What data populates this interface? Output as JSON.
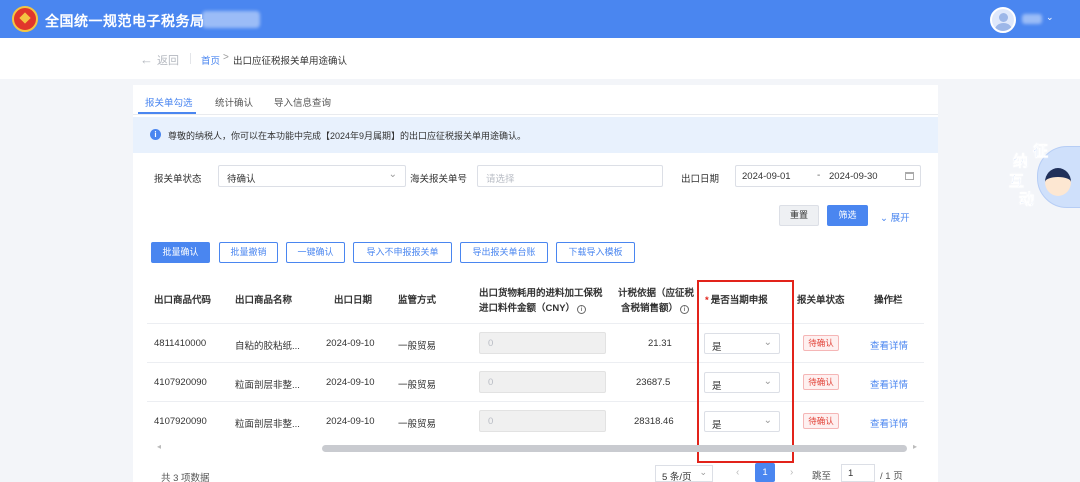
{
  "header": {
    "title": "全国统一规范电子税务局"
  },
  "breadcrumb": {
    "back_label": "返回",
    "home": "首页",
    "separator": ">",
    "current": "出口应征税报关单用途确认"
  },
  "tabs": [
    {
      "label": "报关单勾选",
      "active": true
    },
    {
      "label": "统计确认",
      "active": false
    },
    {
      "label": "导入信息查询",
      "active": false
    }
  ],
  "notice": {
    "icon": "info-icon",
    "text": "尊敬的纳税人，你可以在本功能中完成【2024年9月属期】的出口应征税报关单用途确认。"
  },
  "filters": {
    "status_label": "报关单状态",
    "status_value": "待确认",
    "customs_no_label": "海关报关单号",
    "customs_no_placeholder": "请选择",
    "export_date_label": "出口日期",
    "date_from": "2024-09-01",
    "date_sep": "-",
    "date_to": "2024-09-30",
    "reset_label": "重置",
    "search_label": "筛选",
    "expand_label": "展开"
  },
  "actions": [
    "批量确认",
    "批量撤销",
    "一键确认",
    "导入不申报报关单",
    "导出报关单台账",
    "下载导入模板"
  ],
  "table": {
    "headers": {
      "code": "出口商品代码",
      "name": "出口商品名称",
      "date": "出口日期",
      "supervision": "监管方式",
      "material_line1": "出口货物耗用的进料加工保税",
      "material_line2": "进口料件金额（CNY）",
      "tax_basis_line1": "计税依据（应征税",
      "tax_basis_line2": "含税销售额）",
      "declare": "是否当期申报",
      "status": "报关单状态",
      "ops": "操作栏"
    },
    "rows": [
      {
        "code": "4811410000",
        "name": "自粘的胶粘纸...",
        "date": "2024-09-10",
        "supervision": "一般贸易",
        "material": "0",
        "tax_basis": "21.31",
        "declare": "是",
        "status": "待确认",
        "op": "查看详情"
      },
      {
        "code": "4107920090",
        "name": "粒面剖层非整...",
        "date": "2024-09-10",
        "supervision": "一般贸易",
        "material": "0",
        "tax_basis": "23687.5",
        "declare": "是",
        "status": "待确认",
        "op": "查看详情"
      },
      {
        "code": "4107920090",
        "name": "粒面剖层非整...",
        "date": "2024-09-10",
        "supervision": "一般贸易",
        "material": "0",
        "tax_basis": "28318.46",
        "declare": "是",
        "status": "待确认",
        "op": "查看详情"
      }
    ]
  },
  "pagination": {
    "total": "共 3 项数据",
    "page_size": "5 条/页",
    "current_page": "1",
    "goto_label": "跳至",
    "goto_value": "1",
    "pages": "/ 1 页"
  },
  "mascot": {
    "chars": [
      "征",
      "纳",
      "互",
      "动"
    ]
  },
  "colors": {
    "primary": "#4a86f0",
    "highlight_frame": "#e2231a",
    "status_pending": "#e2443a"
  }
}
